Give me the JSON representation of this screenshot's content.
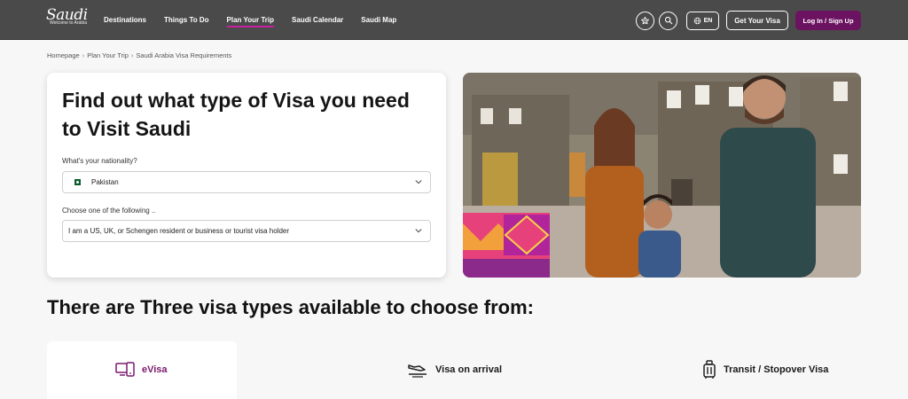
{
  "brand": {
    "logo_script": "Saudi",
    "logo_tagline": "Welcome to Arabia"
  },
  "nav": {
    "links": [
      "Destinations",
      "Things To Do",
      "Plan Your Trip",
      "Saudi Calendar",
      "Saudi Map"
    ],
    "active": "Plan Your Trip",
    "language": "EN",
    "get_visa": "Get Your Visa",
    "login": "Log In / Sign Up",
    "icons": [
      "favorites-star-icon",
      "search-icon",
      "globe-icon"
    ]
  },
  "breadcrumb": [
    "Homepage",
    "Plan Your Trip",
    "Saudi Arabia Visa Requirements"
  ],
  "visa_finder": {
    "title": "Find out what type of Visa you need to Visit Saudi",
    "nationality_label": "What's your nationality?",
    "nationality_value": "Pakistan",
    "option_label": "Choose one of the following ..",
    "option_value": "I am a US, UK, or Schengen resident or business or tourist visa holder"
  },
  "section_title": "There are Three visa types available to choose from:",
  "visa_types": [
    {
      "label": "eVisa",
      "icon": "devices-icon",
      "active": true
    },
    {
      "label": "Visa on arrival",
      "icon": "plane-landing-icon",
      "active": false
    },
    {
      "label": "Transit / Stopover Visa",
      "icon": "luggage-icon",
      "active": false
    }
  ],
  "colors": {
    "nav_bg": "#4a4a4a",
    "accent": "#6b1260",
    "active_tab": "#7a1a6e",
    "underline": "#c61f9f"
  }
}
